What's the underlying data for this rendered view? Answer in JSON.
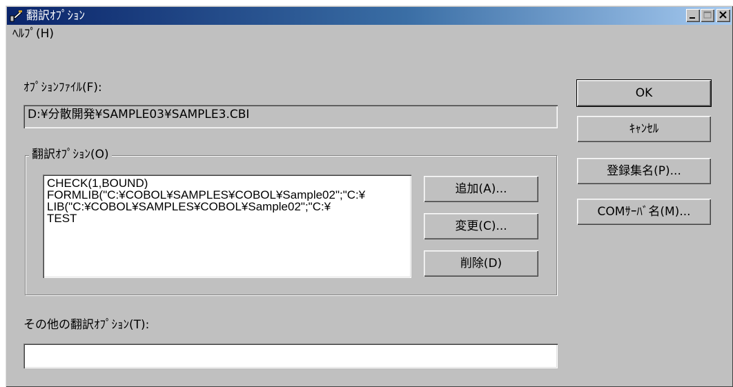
{
  "window": {
    "title": "翻訳ｵﾌﾟｼｮﾝ"
  },
  "menubar": {
    "help": "ﾍﾙﾌﾟ(H)"
  },
  "option_file": {
    "label": "ｵﾌﾟｼｮﾝﾌｧｲﾙ(F):",
    "value": "D:¥分散開発¥SAMPLE03¥SAMPLE3.CBI"
  },
  "translation_options": {
    "group_label": "翻訳ｵﾌﾟｼｮﾝ(O)",
    "items": [
      "CHECK(1,BOUND)",
      "FORMLIB(\"C:¥COBOL¥SAMPLES¥COBOL¥Sample02\";\"C:¥",
      "LIB(\"C:¥COBOL¥SAMPLES¥COBOL¥Sample02\";\"C:¥",
      "TEST"
    ],
    "add_button": "追加(A)...",
    "change_button": "変更(C)...",
    "delete_button": "削除(D)"
  },
  "other_options": {
    "label": "その他の翻訳ｵﾌﾟｼｮﾝ(T):",
    "value": ""
  },
  "buttons": {
    "ok": "OK",
    "cancel": "ｷｬﾝｾﾙ",
    "register_set_name": "登録集名(P)...",
    "com_server_name": "COMｻｰﾊﾞ名(M)..."
  },
  "colors": {
    "face": "#c0c0c0",
    "title_start": "#0a246a",
    "title_end": "#a6caf0"
  }
}
